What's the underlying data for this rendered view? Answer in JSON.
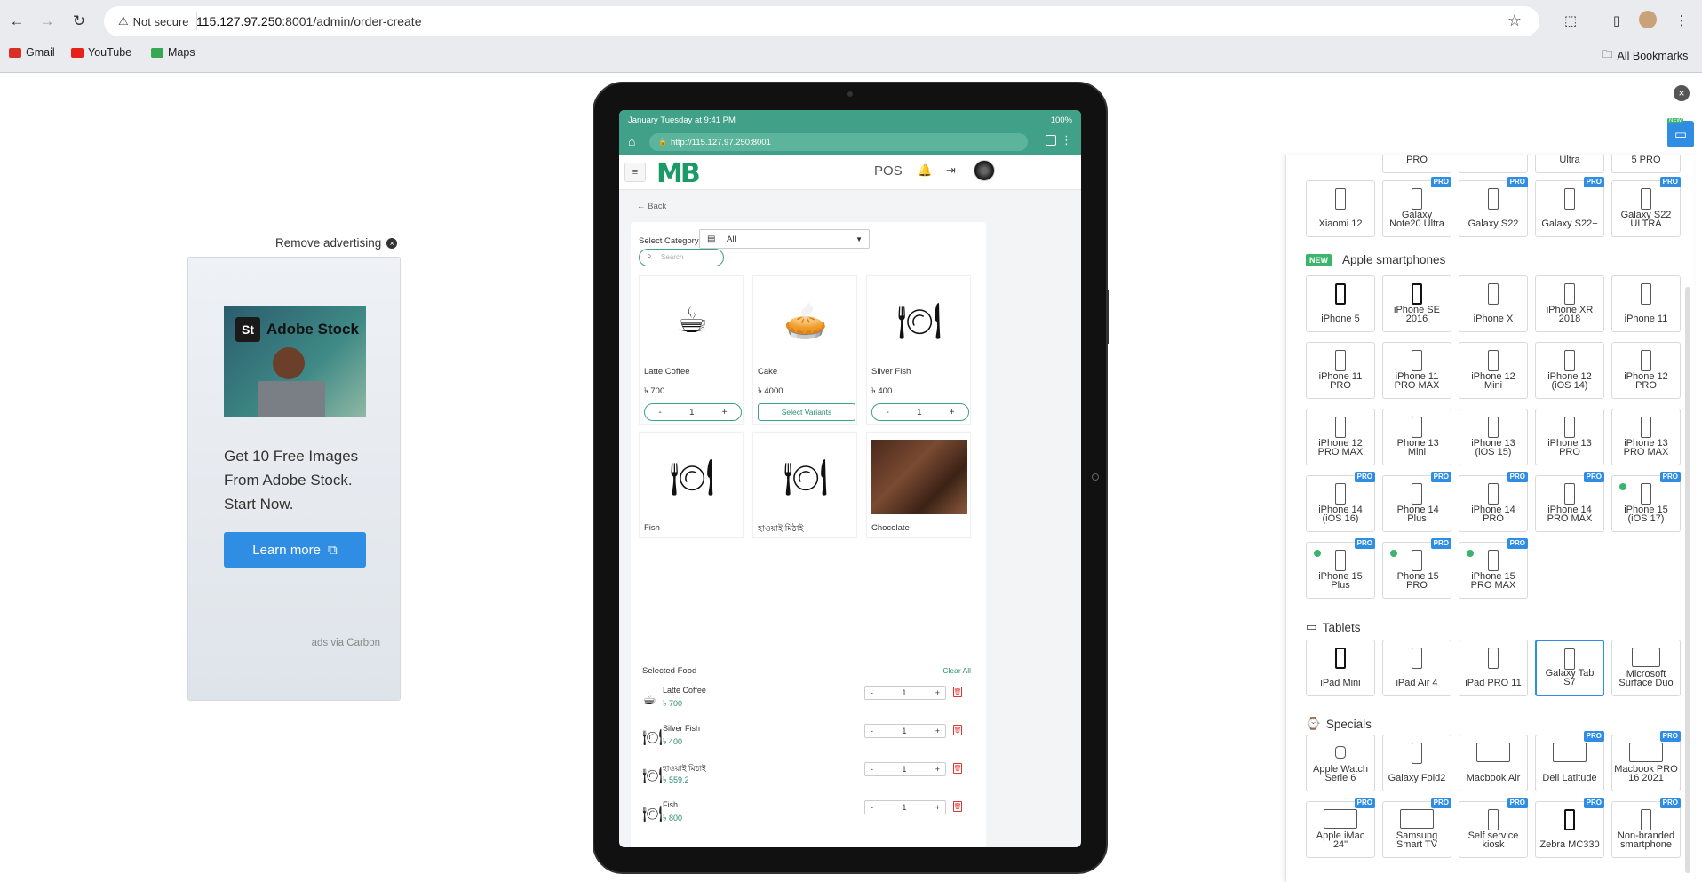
{
  "browser": {
    "security_label": "Not secure",
    "url_host": "115.127.97.250",
    "url_rest": ":8001/admin/order-create",
    "bookmarks": [
      {
        "label": "Gmail",
        "color": "#d93025"
      },
      {
        "label": "YouTube",
        "color": "#e62117"
      },
      {
        "label": "Maps",
        "color": "#34a853"
      }
    ],
    "all_bookmarks": "All Bookmarks"
  },
  "ad": {
    "remove_label": "Remove advertising",
    "brand_badge": "St",
    "brand_name": "Adobe Stock",
    "text": "Get 10 Free Images From Adobe Stock. Start Now.",
    "cta": "Learn more",
    "via": "ads via Carbon"
  },
  "tablet": {
    "status_left": "January Tuesday at 9:41 PM",
    "status_right": "100%",
    "url": "http://115.127.97.250:8001",
    "logo": "MB",
    "pos_label": "POS",
    "back_label": "Back",
    "category_label": "Select Category",
    "category_value": "All",
    "search_placeholder": "Search",
    "products": [
      {
        "name": "Latte Coffee",
        "price": "৳ 700",
        "icon": "coffee-cup-icon",
        "glyph": "☕",
        "action": "qty",
        "qty": "1"
      },
      {
        "name": "Cake",
        "price": "৳ 4000",
        "icon": "cake-icon",
        "glyph": "🥧",
        "action": "variants",
        "variants_label": "Select Variants"
      },
      {
        "name": "Silver Fish",
        "price": "৳ 400",
        "icon": "plate-cutlery-icon",
        "glyph": "🍽",
        "action": "qty",
        "qty": "1"
      },
      {
        "name": "Fish",
        "icon": "plate-cutlery-icon",
        "glyph": "🍽"
      },
      {
        "name": "হাওয়াই মিঠাই",
        "icon": "plate-cutlery-icon",
        "glyph": "🍽"
      },
      {
        "name": "Chocolate",
        "icon": "chocolate-photo"
      }
    ],
    "selected_title": "Selected Food",
    "clear_all": "Clear All",
    "selected": [
      {
        "name": "Latte Coffee",
        "price": "৳ 700",
        "qty": "1"
      },
      {
        "name": "Silver Fish",
        "price": "৳ 400",
        "qty": "1"
      },
      {
        "name": "হাওয়াই মিঠাই",
        "price": "৳ 559.2",
        "qty": "1"
      },
      {
        "name": "Fish",
        "price": "৳ 800",
        "qty": "1"
      }
    ]
  },
  "panel": {
    "android_row_partial": [
      "PRO",
      "",
      "Ultra",
      "5 PRO"
    ],
    "android_row": [
      {
        "label": "Xiaomi 12",
        "pro": false
      },
      {
        "label": "Galaxy Note20 Ultra",
        "pro": true
      },
      {
        "label": "Galaxy S22",
        "pro": true
      },
      {
        "label": "Galaxy S22+",
        "pro": true
      },
      {
        "label": "Galaxy S22 ULTRA",
        "pro": true
      }
    ],
    "apple_title": "Apple smartphones",
    "new_badge": "NEW",
    "pro_badge": "PRO",
    "apple": [
      {
        "label": "iPhone 5",
        "pro": false,
        "dark": true
      },
      {
        "label": "iPhone SE 2016",
        "pro": false,
        "dark": true
      },
      {
        "label": "iPhone X",
        "pro": false
      },
      {
        "label": "iPhone XR 2018",
        "pro": false
      },
      {
        "label": "iPhone 11",
        "pro": false
      },
      {
        "label": "iPhone 11 PRO",
        "pro": false
      },
      {
        "label": "iPhone 11 PRO MAX",
        "pro": false
      },
      {
        "label": "iPhone 12 Mini",
        "pro": false
      },
      {
        "label": "iPhone 12 (iOS 14)",
        "pro": false
      },
      {
        "label": "iPhone 12 PRO",
        "pro": false
      },
      {
        "label": "iPhone 12 PRO MAX",
        "pro": false
      },
      {
        "label": "iPhone 13 Mini",
        "pro": false
      },
      {
        "label": "iPhone 13 (iOS 15)",
        "pro": false
      },
      {
        "label": "iPhone 13 PRO",
        "pro": false
      },
      {
        "label": "iPhone 13 PRO MAX",
        "pro": false
      },
      {
        "label": "iPhone 14 (iOS 16)",
        "pro": true
      },
      {
        "label": "iPhone 14 Plus",
        "pro": true
      },
      {
        "label": "iPhone 14 PRO",
        "pro": true
      },
      {
        "label": "iPhone 14 PRO MAX",
        "pro": true
      },
      {
        "label": "iPhone 15 (iOS 17)",
        "pro": true,
        "new_dot": true
      },
      {
        "label": "iPhone 15 Plus",
        "pro": true,
        "new_dot": true
      },
      {
        "label": "iPhone 15 PRO",
        "pro": true,
        "new_dot": true
      },
      {
        "label": "iPhone 15 PRO MAX",
        "pro": true,
        "new_dot": true
      }
    ],
    "tablets_title": "Tablets",
    "tablets": [
      {
        "label": "iPad Mini",
        "pro": false,
        "dark": true
      },
      {
        "label": "iPad Air 4",
        "pro": false
      },
      {
        "label": "iPad PRO 11",
        "pro": false
      },
      {
        "label": "Galaxy Tab S7",
        "pro": false,
        "active": true
      },
      {
        "label": "Microsoft Surface Duo",
        "pro": false,
        "shape": "duo"
      }
    ],
    "specials_title": "Specials",
    "specials": [
      {
        "label": "Apple Watch Serie 6",
        "pro": false,
        "shape": "watch"
      },
      {
        "label": "Galaxy Fold2",
        "pro": false
      },
      {
        "label": "Macbook Air",
        "pro": false,
        "shape": "laptop"
      },
      {
        "label": "Dell Latitude",
        "pro": true,
        "shape": "laptop"
      },
      {
        "label": "Macbook PRO 16 2021",
        "pro": true,
        "shape": "laptop"
      },
      {
        "label": "Apple iMac 24\"",
        "pro": true,
        "shape": "laptop"
      },
      {
        "label": "Samsung Smart TV",
        "pro": true,
        "shape": "laptop"
      },
      {
        "label": "Self service kiosk",
        "pro": true
      },
      {
        "label": "Zebra MC330",
        "pro": true,
        "dark": true
      },
      {
        "label": "Non-branded smartphone",
        "pro": true
      }
    ]
  }
}
